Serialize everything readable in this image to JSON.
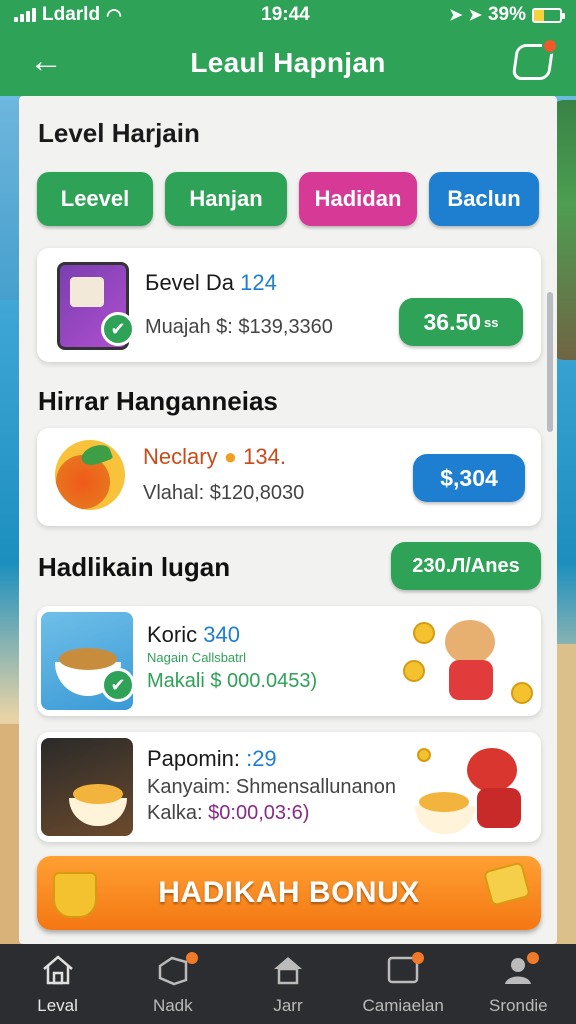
{
  "status_bar": {
    "carrier": "Ldarld",
    "time": "19:44",
    "battery": "39%",
    "battery_level": 0.39
  },
  "header": {
    "title": "Leaul Hapnjan",
    "back_icon": "arrow-left-icon",
    "action_icon": "notification-icon"
  },
  "page": {
    "heading": "Level Harjain",
    "tabs": [
      {
        "label": "Leevel",
        "color": "#2ea257"
      },
      {
        "label": "Hanjan",
        "color": "#2ea257"
      },
      {
        "label": "Hadidan",
        "color": "#d63996"
      },
      {
        "label": "Baclun",
        "color": "#1e7fd0"
      }
    ]
  },
  "card1": {
    "title_a": "Бevel Da",
    "title_b": "124",
    "subtitle": "Muajah $: $139,3360",
    "price": "36.50",
    "price_suffix": "ss"
  },
  "section2": {
    "heading": "Hirrar Hanganneias"
  },
  "card2": {
    "title_a": "Neclary",
    "title_b": "134.",
    "subtitle": "Vlahal: $120,8030",
    "price": "$,304"
  },
  "section3": {
    "heading": "Hadlikain lugan",
    "pill": "230.Л/Anes"
  },
  "card3": {
    "title_a": "Koric",
    "title_b": "340",
    "line2": "Nagain Callsbatrl",
    "line3": "Makali $ 000.0453)"
  },
  "card4": {
    "title_a": "Papomin:",
    "title_b": ":29",
    "line2": "Kanyaim: Shmensallunanon",
    "line3_a": "Kalka:",
    "line3_b": "$0:00,03:6)"
  },
  "bonus": {
    "label": "HADIKAH BONUX"
  },
  "bottom_nav": [
    {
      "label": "Leval",
      "icon": "home-icon"
    },
    {
      "label": "Nadk",
      "icon": "box-icon"
    },
    {
      "label": "Jarr",
      "icon": "house-icon"
    },
    {
      "label": "Camiaelan",
      "icon": "tablet-icon"
    },
    {
      "label": "Srondie",
      "icon": "profile-icon"
    }
  ],
  "colors": {
    "brand_green": "#2ea257",
    "pink": "#d63996",
    "blue": "#1e7fd0",
    "orange": "#f47712"
  }
}
